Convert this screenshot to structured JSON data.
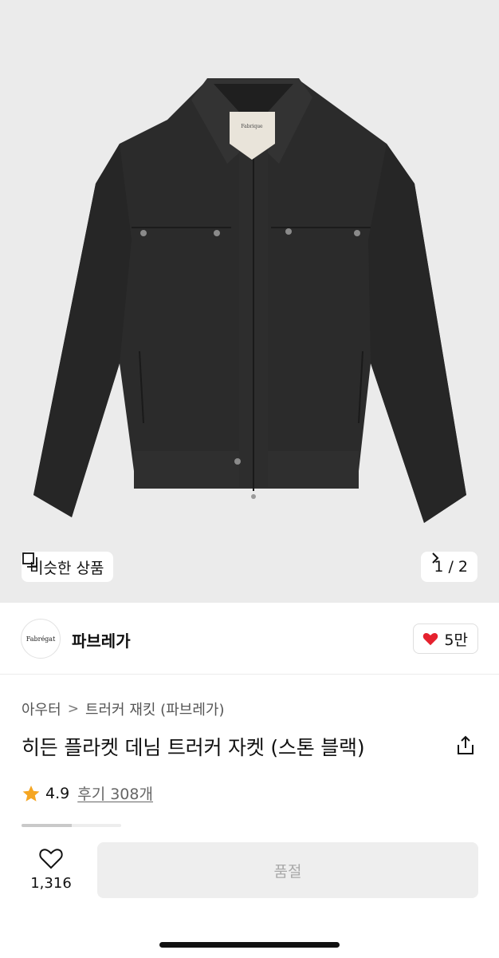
{
  "hero": {
    "product_image": "dark charcoal trucker jacket",
    "jacket_tag_text": "Fabrique",
    "similar_label": "비슷한 상품",
    "similar_icon": "copy-icon",
    "pager": {
      "current": "1",
      "separator": "/",
      "total": "2"
    }
  },
  "brand": {
    "logo_text": "Fabrégat",
    "name": "파브레가",
    "likes": "5만",
    "like_icon": "heart-filled-icon",
    "like_color": "#e5212e"
  },
  "product": {
    "breadcrumb": [
      "아우터",
      "트러커 재킷 (파브레가)"
    ],
    "title": "히든 플라켓 데님 트러커 자켓 (스톤 블랙)",
    "rating": "4.9",
    "reviews": "후기 308개",
    "star_color": "#f5a623",
    "image_progress": 0.5
  },
  "bottom": {
    "wish_count": "1,316",
    "buy_label": "품절"
  }
}
